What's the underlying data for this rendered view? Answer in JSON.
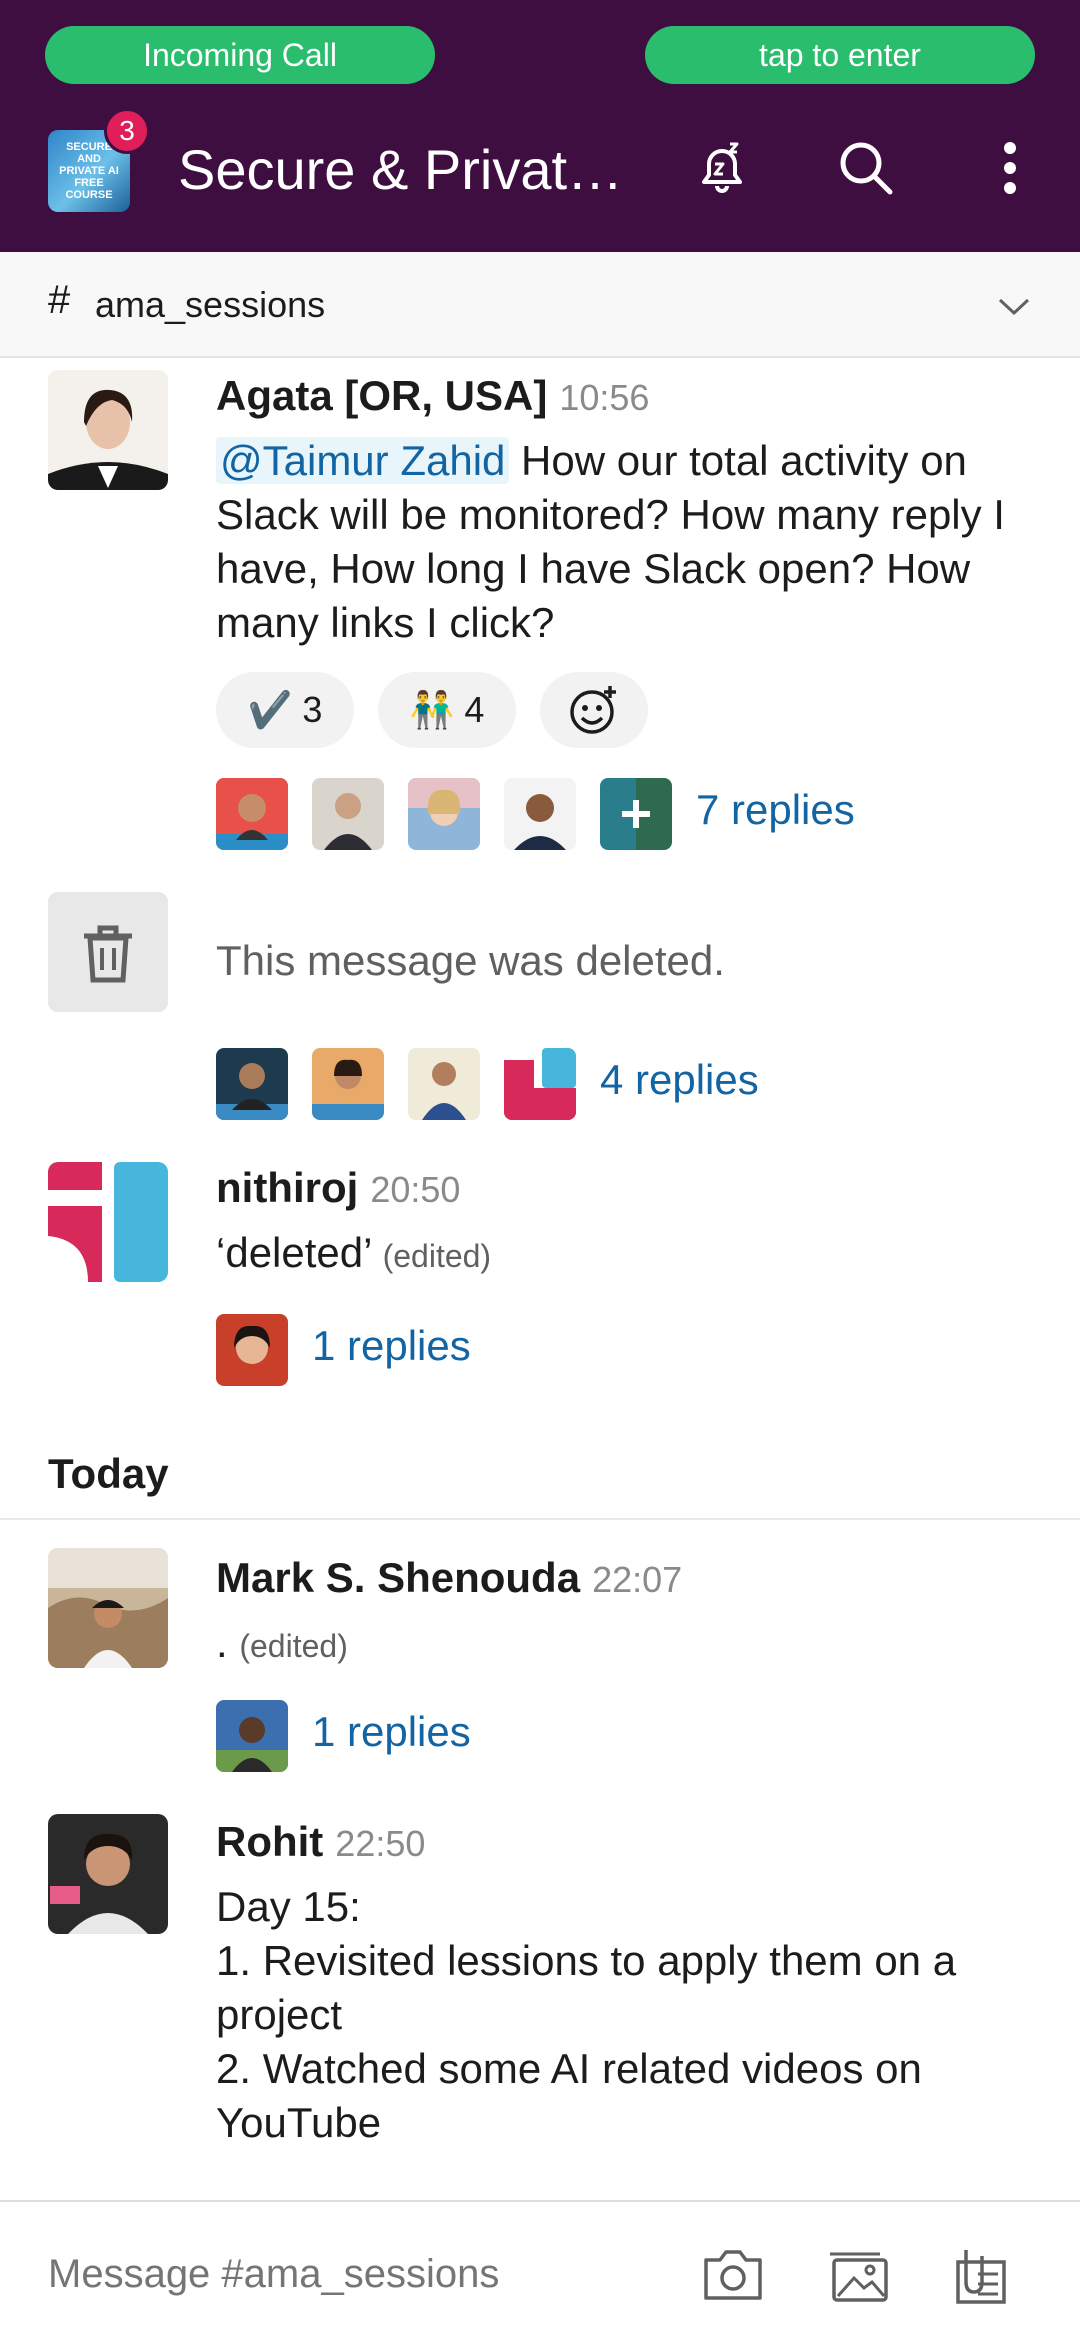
{
  "call_banner": {
    "left_label": "Incoming Call",
    "right_label": "tap to enter"
  },
  "header": {
    "workspace_logo_text": "SECURE AND PRIVATE AI FREE COURSE",
    "badge_count": "3",
    "workspace_title": "Secure & Privat…",
    "icons": [
      "snooze-bell-icon",
      "search-icon",
      "more-vertical-icon"
    ]
  },
  "channel": {
    "hash": "#",
    "name": "ama_sessions"
  },
  "messages": [
    {
      "author": "Agata [OR, USA]",
      "time": "10:56",
      "mention": "@Taimur Zahid",
      "text": " How our total activity on Slack will be monitored? How many reply I have, How long I have Slack open? How many links I click?",
      "reactions": [
        {
          "emoji": "✔️",
          "count": "3"
        },
        {
          "emoji": "👬",
          "count": "4"
        }
      ],
      "replies": "7 replies"
    },
    {
      "deleted_text": "This message was deleted.",
      "replies": "4 replies"
    },
    {
      "author": "nithiroj",
      "time": "20:50",
      "text": "‘deleted’",
      "edited": "(edited)",
      "replies": "1 replies"
    }
  ],
  "section_label": "Today",
  "today_messages": [
    {
      "author": "Mark S. Shenouda",
      "time": "22:07",
      "text": ".",
      "edited": "(edited)",
      "replies": "1 replies"
    },
    {
      "author": "Rohit",
      "time": "22:50",
      "lines": [
        "Day 15:",
        "1. Revisited lessions to apply them on a project",
        "2. Watched some AI related videos on YouTube"
      ]
    }
  ],
  "composer": {
    "placeholder": "Message #ama_sessions"
  },
  "colors": {
    "aubergine": "#3f0e40",
    "call_green": "#2bbd6e",
    "link_blue": "#1264a3",
    "badge_red": "#e01e5a"
  }
}
